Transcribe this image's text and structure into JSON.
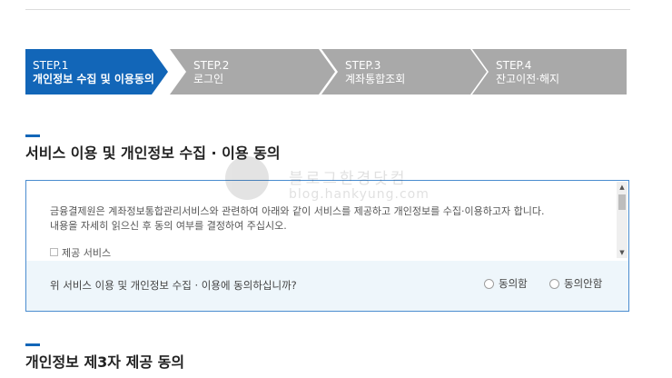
{
  "steps": [
    {
      "num": "STEP.1",
      "label": "개인정보 수집 및 이용동의",
      "state": "active"
    },
    {
      "num": "STEP.2",
      "label": "로그인",
      "state": "inactive"
    },
    {
      "num": "STEP.3",
      "label": "계좌통합조회",
      "state": "inactive"
    },
    {
      "num": "STEP.4",
      "label": "잔고이전·해지",
      "state": "inactive"
    }
  ],
  "section1": {
    "title": "서비스 이용 및 개인정보 수집 · 이용 동의",
    "paragraph_line1": "금융결제원은 계좌정보통합관리서비스와 관련하여 아래와 같이 서비스를 제공하고 개인정보를 수집·이용하고자 합니다.",
    "paragraph_line2": "내용을 자세히 읽으신 후 동의 여부를 결정하여 주십시오.",
    "item_label": "제공 서비스",
    "question": "위 서비스 이용 및 개인정보 수집 · 이용에 동의하십니까?",
    "agree_label": "동의함",
    "disagree_label": "동의안함"
  },
  "section2": {
    "title": "개인정보 제3자 제공 동의"
  },
  "watermark": {
    "line1": "블로그한경닷컴",
    "line2": "blog.hankyung.com"
  },
  "colors": {
    "accent": "#1266b8",
    "step_inactive": "#a9a9a9",
    "box_border": "#4a8ccf",
    "question_bg": "#eef6fb"
  }
}
